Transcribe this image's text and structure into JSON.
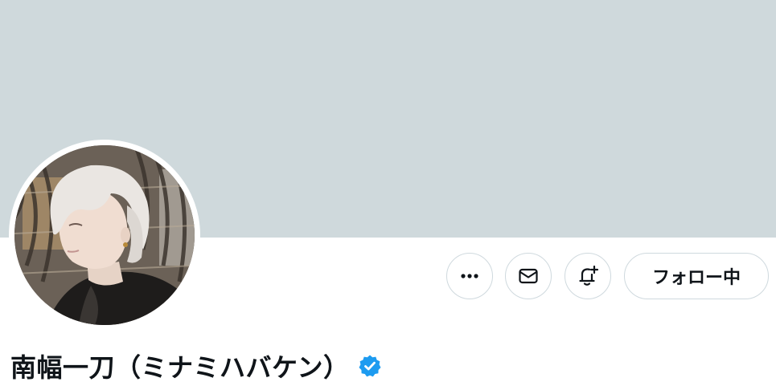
{
  "colors": {
    "banner": "#cfd9dc",
    "border": "#cfd9de",
    "text": "#0f1419",
    "verified": "#1d9bf0"
  },
  "profile": {
    "display_name": "南幅一刀（ミナミハバケン）",
    "verified_badge_icon": "verified-check-icon",
    "avatar": "profile-photo"
  },
  "actions": {
    "more_icon": "more-horizontal-icon",
    "dm_icon": "mail-icon",
    "notify_icon": "bell-plus-icon",
    "follow_label": "フォロー中"
  }
}
